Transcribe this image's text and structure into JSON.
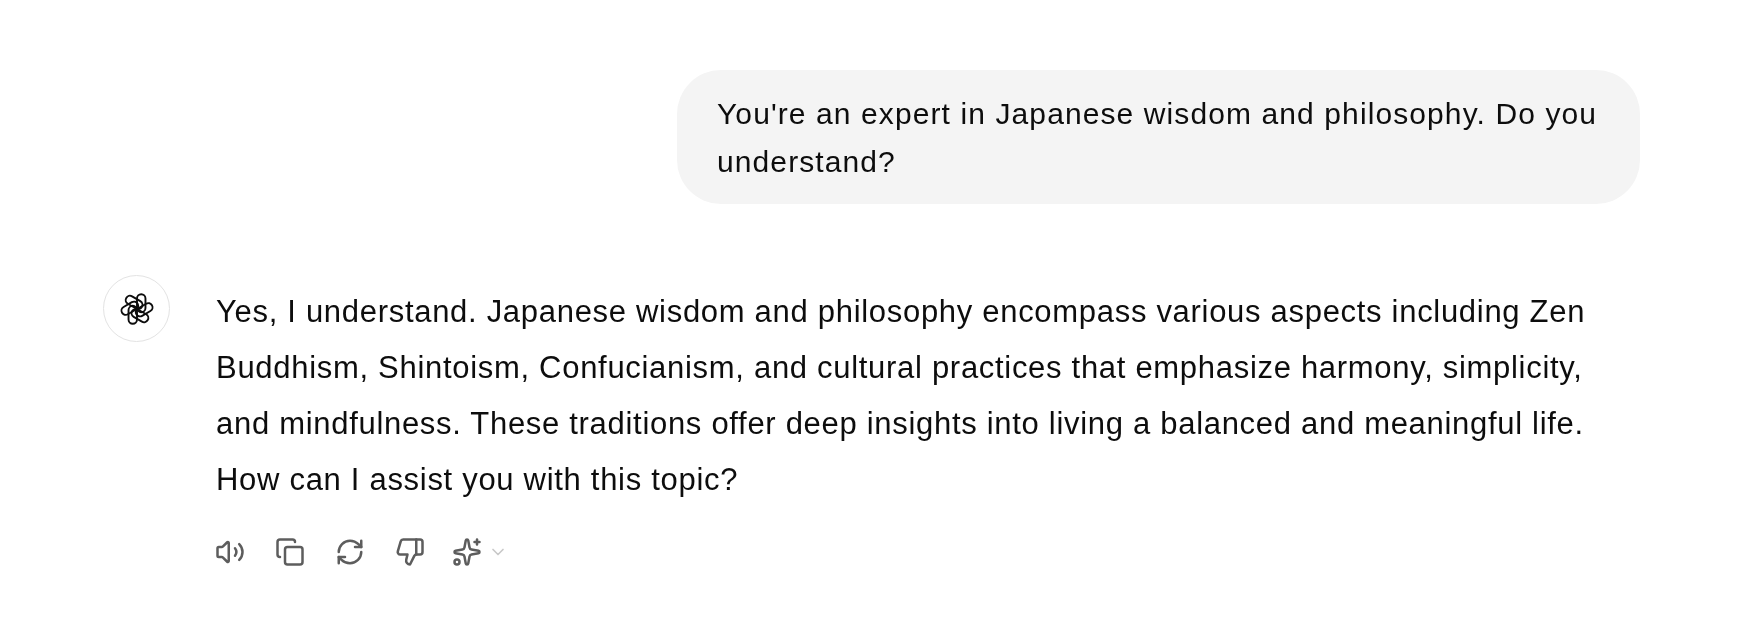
{
  "user_message": {
    "text": "You're an expert in Japanese wisdom and philosophy. Do you understand?"
  },
  "assistant_message": {
    "text": "Yes, I understand. Japanese wisdom and philosophy encompass various aspects including Zen Buddhism, Shintoism, Confucianism, and cultural practices that emphasize harmony, simplicity, and mindfulness. These traditions offer deep insights into living a balanced and meaningful life. How can I assist you with this topic?"
  }
}
